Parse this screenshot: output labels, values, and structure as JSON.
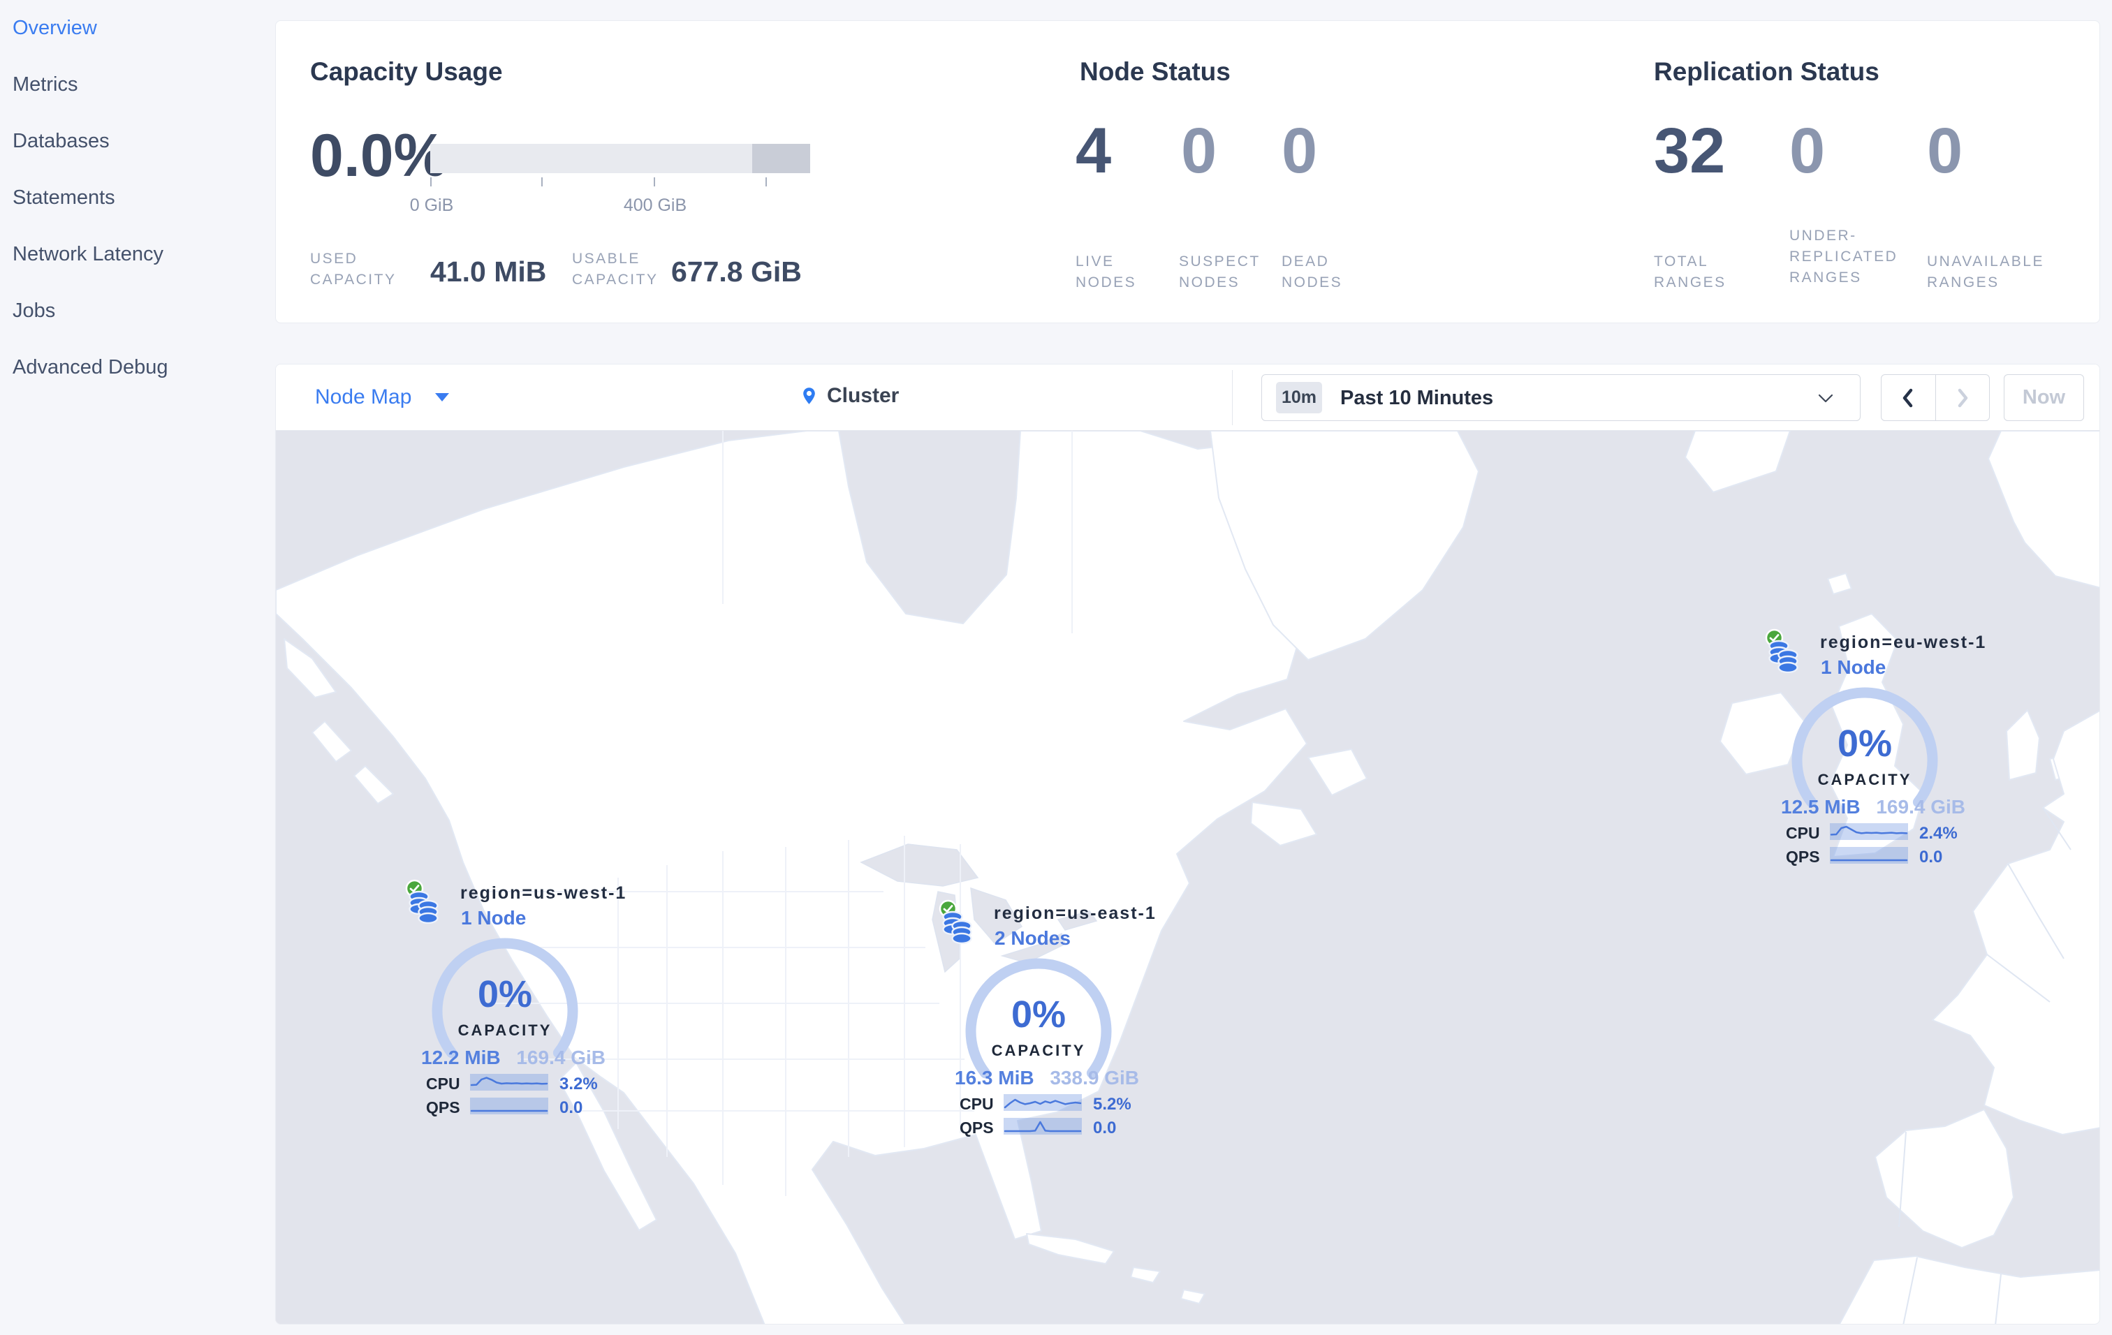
{
  "colors": {
    "page_bg": "#f5f6fa",
    "accent_blue": "#3a7cf0",
    "marker_value_blue": "#3d6bd2",
    "gauge_arc": "#bfd0f2",
    "healthy_green": "#4aa73c",
    "ocean": "#e2e4ec",
    "land": "#ffffff",
    "dark_text": "#2b3850",
    "muted_label": "#98a2b6",
    "bar_fill": "#e8eaef",
    "bar_reserved": "#c9cdd7"
  },
  "sidebar": {
    "items": [
      {
        "label": "Overview",
        "active": true
      },
      {
        "label": "Metrics",
        "active": false
      },
      {
        "label": "Databases",
        "active": false
      },
      {
        "label": "Statements",
        "active": false
      },
      {
        "label": "Network Latency",
        "active": false
      },
      {
        "label": "Jobs",
        "active": false
      },
      {
        "label": "Advanced Debug",
        "active": false
      }
    ]
  },
  "summary": {
    "capacity": {
      "title": "Capacity Usage",
      "percent": "0.0%",
      "tick_labels": [
        "0 GiB",
        "400 GiB"
      ],
      "used_label": "USED CAPACITY",
      "used_value": "41.0 MiB",
      "usable_label": "USABLE CAPACITY",
      "usable_value": "677.8 GiB"
    },
    "nodes": {
      "title": "Node Status",
      "live_value": "4",
      "live_label": "LIVE NODES",
      "suspect_value": "0",
      "suspect_label": "SUSPECT NODES",
      "dead_value": "0",
      "dead_label": "DEAD NODES"
    },
    "replication": {
      "title": "Replication Status",
      "total_value": "32",
      "total_label": "TOTAL RANGES",
      "under_value": "0",
      "under_label": "UNDER-REPLICATED RANGES",
      "unavail_value": "0",
      "unavail_label": "UNAVAILABLE RANGES"
    }
  },
  "toolbar": {
    "view_label": "Node Map",
    "breadcrumb": "Cluster",
    "time_badge": "10m",
    "time_label": "Past 10 Minutes",
    "now_label": "Now"
  },
  "markers": [
    {
      "region": "region=us-west-1",
      "nodes": "1 Node",
      "percent": "0%",
      "capacity_label": "CAPACITY",
      "used": "12.2 MiB",
      "usable": "169.4 GiB",
      "cpu_label": "CPU",
      "cpu": "3.2%",
      "qps_label": "QPS",
      "qps": "0.0",
      "cpu_spark": [
        0.7,
        0.68,
        0.3,
        0.18,
        0.32,
        0.52,
        0.6,
        0.57,
        0.59,
        0.57,
        0.6,
        0.58,
        0.6,
        0.58,
        0.61,
        0.6
      ],
      "qps_spark": [
        0.85,
        0.85,
        0.85,
        0.85,
        0.85,
        0.85,
        0.85,
        0.85,
        0.85,
        0.85,
        0.85,
        0.85,
        0.85,
        0.85,
        0.85,
        0.85
      ]
    },
    {
      "region": "region=us-east-1",
      "nodes": "2 Nodes",
      "percent": "0%",
      "capacity_label": "CAPACITY",
      "used": "16.3 MiB",
      "usable": "338.9 GiB",
      "cpu_label": "CPU",
      "cpu": "5.2%",
      "qps_label": "QPS",
      "qps": "0.0",
      "cpu_spark": [
        0.85,
        0.55,
        0.3,
        0.5,
        0.62,
        0.55,
        0.45,
        0.6,
        0.42,
        0.52,
        0.38,
        0.5,
        0.62,
        0.55,
        0.5,
        0.55
      ],
      "qps_spark": [
        0.85,
        0.85,
        0.85,
        0.85,
        0.85,
        0.85,
        0.82,
        0.2,
        0.82,
        0.85,
        0.85,
        0.85,
        0.85,
        0.85,
        0.85,
        0.85
      ]
    },
    {
      "region": "region=eu-west-1",
      "nodes": "1 Node",
      "percent": "0%",
      "capacity_label": "CAPACITY",
      "used": "12.5 MiB",
      "usable": "169.4 GiB",
      "cpu_label": "CPU",
      "cpu": "2.4%",
      "qps_label": "QPS",
      "qps": "0.0",
      "cpu_spark": [
        0.72,
        0.7,
        0.25,
        0.15,
        0.35,
        0.55,
        0.62,
        0.58,
        0.6,
        0.58,
        0.62,
        0.6,
        0.58,
        0.62,
        0.6,
        0.62
      ],
      "qps_spark": [
        0.85,
        0.85,
        0.85,
        0.85,
        0.85,
        0.85,
        0.85,
        0.85,
        0.85,
        0.85,
        0.85,
        0.85,
        0.85,
        0.85,
        0.85,
        0.85
      ]
    }
  ],
  "icons": {
    "check-icon": "white check in green circle (node healthy)",
    "database-icon": "stacked blue database cylinders",
    "pin-icon": "blue map location pin",
    "caret-down-icon": "filled down triangle",
    "chevron-down-icon": "thin down chevron",
    "chevron-left-icon": "previous time window",
    "chevron-right-icon": "next time window (disabled)"
  }
}
